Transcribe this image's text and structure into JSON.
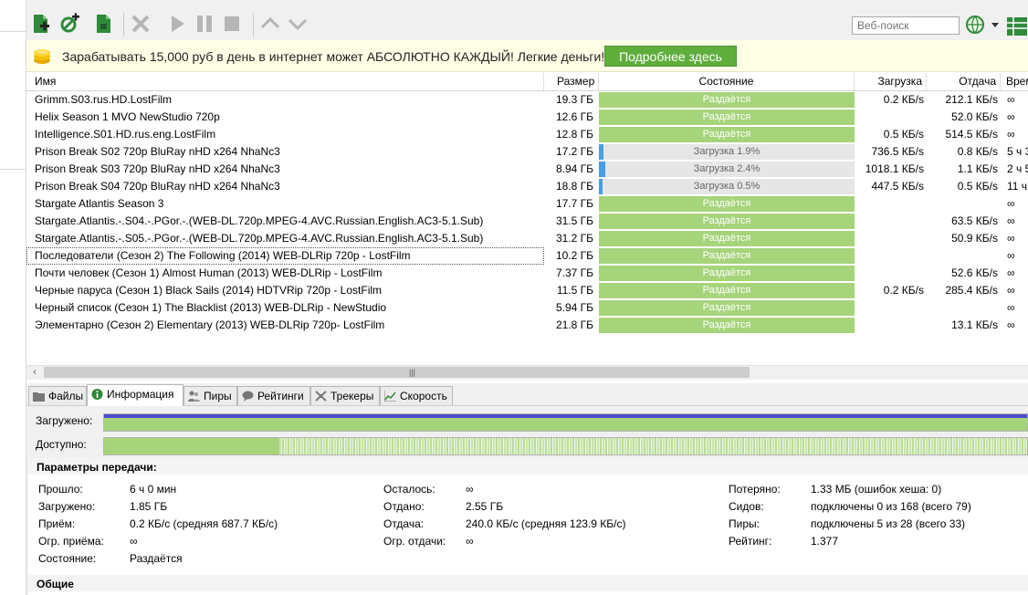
{
  "search": {
    "placeholder": "Веб-поиск"
  },
  "ad": {
    "text": "Зарабатывать 15,000 руб в день в интернет может АБСОЛЮТНО КАЖДЫЙ! Легкие деньги!",
    "button": "Подробнее здесь"
  },
  "columns": {
    "name": "Имя",
    "size": "Размер",
    "state": "Состояние",
    "down": "Загрузка",
    "up": "Отдача",
    "time": "Время"
  },
  "torrents": [
    {
      "name": "Grimm.S03.rus.HD.LostFilm",
      "size": "19.3 ГБ",
      "state": "Раздаётся",
      "kind": "seed",
      "progress": 100,
      "down": "0.2 КБ/s",
      "up": "212.1 КБ/s",
      "time": "∞"
    },
    {
      "name": "Helix Season 1 MVO NewStudio 720p",
      "size": "12.6 ГБ",
      "state": "Раздаётся",
      "kind": "seed",
      "progress": 100,
      "down": "",
      "up": "52.0 КБ/s",
      "time": "∞"
    },
    {
      "name": "Intelligence.S01.HD.rus.eng.LostFilm",
      "size": "12.8 ГБ",
      "state": "Раздаётся",
      "kind": "seed",
      "progress": 100,
      "down": "0.5 КБ/s",
      "up": "514.5 КБ/s",
      "time": "∞"
    },
    {
      "name": "Prison Break S02 720p BluRay nHD x264 NhaNc3",
      "size": "17.2 ГБ",
      "state": "Загрузка 1.9%",
      "kind": "dl",
      "progress": 1.9,
      "down": "736.5 КБ/s",
      "up": "0.8 КБ/s",
      "time": "5 ч 3"
    },
    {
      "name": "Prison Break S03 720p BluRay nHD x264 NhaNc3",
      "size": "8.94 ГБ",
      "state": "Загрузка 2.4%",
      "kind": "dl",
      "progress": 2.4,
      "down": "1018.1 КБ/s",
      "up": "1.1 КБ/s",
      "time": "2 ч 5"
    },
    {
      "name": "Prison Break S04 720p BluRay nHD x264 NhaNc3",
      "size": "18.8 ГБ",
      "state": "Загрузка 0.5%",
      "kind": "dl",
      "progress": 0.5,
      "down": "447.5 КБ/s",
      "up": "0.5 КБ/s",
      "time": "11 ч"
    },
    {
      "name": "Stargate Atlantis Season 3",
      "size": "17.7 ГБ",
      "state": "Раздаётся",
      "kind": "seed",
      "progress": 100,
      "down": "",
      "up": "",
      "time": "∞"
    },
    {
      "name": "Stargate.Atlantis.-.S04.-.PGor.-.(WEB-DL.720p.MPEG-4.AVC.Russian.English.AC3-5.1.Sub)",
      "size": "31.5 ГБ",
      "state": "Раздаётся",
      "kind": "seed",
      "progress": 100,
      "down": "",
      "up": "63.5 КБ/s",
      "time": "∞"
    },
    {
      "name": "Stargate.Atlantis.-.S05.-.PGor.-.(WEB-DL.720p.MPEG-4.AVC.Russian.English.AC3-5.1.Sub)",
      "size": "31.2 ГБ",
      "state": "Раздаётся",
      "kind": "seed",
      "progress": 100,
      "down": "",
      "up": "50.9 КБ/s",
      "time": "∞"
    },
    {
      "name": "Последователи (Сезон 2) The Following (2014) WEB-DLRip 720p - LostFilm",
      "size": "10.2 ГБ",
      "state": "Раздаётся",
      "kind": "seed",
      "progress": 100,
      "down": "",
      "up": "",
      "time": "∞",
      "selected": true
    },
    {
      "name": "Почти человек (Сезон 1) Almost Human (2013) WEB-DLRip - LostFilm",
      "size": "7.37 ГБ",
      "state": "Раздаётся",
      "kind": "seed",
      "progress": 100,
      "down": "",
      "up": "52.6 КБ/s",
      "time": "∞"
    },
    {
      "name": "Черные паруса (Сезон 1) Black Sails (2014) HDTVRip 720p - LostFilm",
      "size": "11.5 ГБ",
      "state": "Раздаётся",
      "kind": "seed",
      "progress": 100,
      "down": "0.2 КБ/s",
      "up": "285.4 КБ/s",
      "time": "∞"
    },
    {
      "name": "Черный список (Сезон 1) The Blacklist (2013) WEB-DLRip - NewStudio",
      "size": "5.94 ГБ",
      "state": "Раздаётся",
      "kind": "seed",
      "progress": 100,
      "down": "",
      "up": "",
      "time": "∞"
    },
    {
      "name": "Элементарно (Сезон 2) Elementary (2013) WEB-DLRip 720p- LostFilm",
      "size": "21.8 ГБ",
      "state": "Раздаётся",
      "kind": "seed",
      "progress": 100,
      "down": "",
      "up": "13.1 КБ/s",
      "time": "∞"
    }
  ],
  "tabs": [
    {
      "label": "Файлы",
      "icon": "folder-icon"
    },
    {
      "label": "Информация",
      "icon": "info-icon",
      "active": true
    },
    {
      "label": "Пиры",
      "icon": "peers-icon"
    },
    {
      "label": "Рейтинги",
      "icon": "speech-bubble-icon"
    },
    {
      "label": "Трекеры",
      "icon": "trackers-icon"
    },
    {
      "label": "Скорость",
      "icon": "speed-graph-icon"
    }
  ],
  "info": {
    "downloaded_label": "Загружено:",
    "available_label": "Доступно:",
    "downloaded_fraction": 1.0,
    "available_solid_fraction": 0.19,
    "params_title": "Параметры передачи:",
    "general_title": "Общие",
    "col1": [
      {
        "k": "Прошло:",
        "v": "6 ч 0 мин"
      },
      {
        "k": "Загружено:",
        "v": "1.85 ГБ"
      },
      {
        "k": "Приём:",
        "v": "0.2 КБ/с (средняя 687.7 КБ/с)"
      },
      {
        "k": "Огр. приёма:",
        "v": "∞"
      },
      {
        "k": "Состояние:",
        "v": "Раздаётся"
      }
    ],
    "col2": [
      {
        "k": "Осталось:",
        "v": "∞"
      },
      {
        "k": "Отдано:",
        "v": "2.55 ГБ"
      },
      {
        "k": "Отдача:",
        "v": "240.0 КБ/с (средняя 123.9 КБ/с)"
      },
      {
        "k": "Огр. отдачи:",
        "v": "∞"
      }
    ],
    "col3": [
      {
        "k": "Потеряно:",
        "v": "1.33 МБ (ошибок хеша: 0)"
      },
      {
        "k": "Сидов:",
        "v": "подключены 0 из 168 (всего 79)"
      },
      {
        "k": "Пиры:",
        "v": "подключены 5 из 28 (всего 33)"
      },
      {
        "k": "Рейтинг:",
        "v": "1.377"
      }
    ]
  },
  "colors": {
    "seed": "#a6d47b",
    "dl_fill": "#4a9ce6",
    "ad_button": "#5fae3c",
    "downloaded_line": "#4c4ccc"
  }
}
